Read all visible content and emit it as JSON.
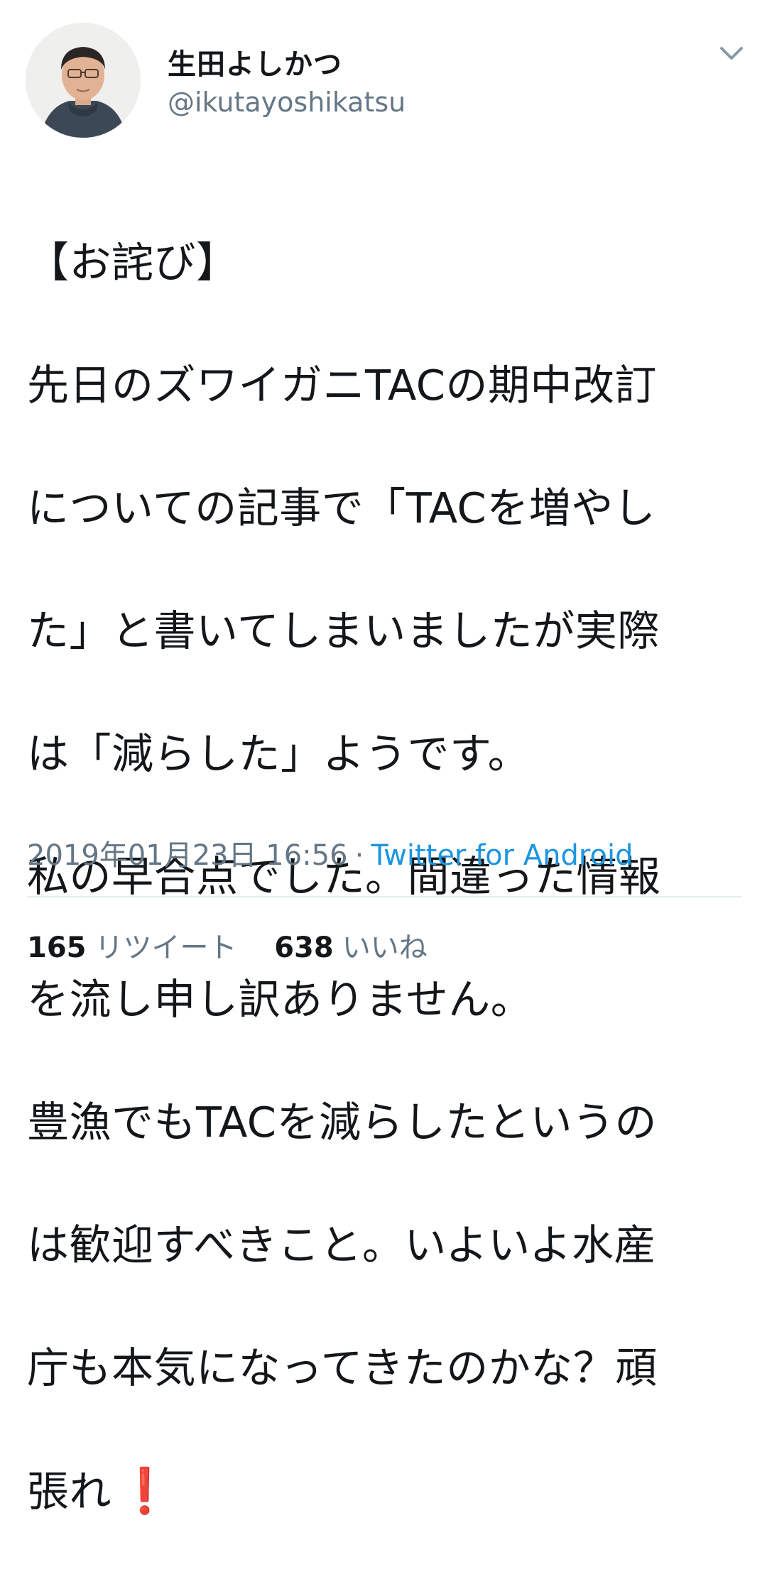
{
  "user": {
    "display_name": "生田よしかつ",
    "handle": "@ikutayoshikatsu"
  },
  "tweet": {
    "lines": [
      "【お詫び】",
      "先日のズワイガニTACの期中改訂",
      "についての記事で「TACを増やし",
      "た」と書いてしまいましたが実際",
      "は「減らした」ようです。",
      "私の早合点でした。間違った情報",
      "を流し申し訳ありません。",
      "豊漁でもTACを減らしたというの",
      "は歓迎すべきこと。いよいよ水産",
      "庁も本気になってきたのかな？頑",
      "張れ"
    ],
    "emoji": "❗"
  },
  "meta": {
    "timestamp": "2019年01月23日 16:56",
    "separator": "·",
    "source": "Twitter for Android"
  },
  "stats": {
    "retweets_count": "165",
    "retweets_label": "リツイート",
    "likes_count": "638",
    "likes_label": "いいね"
  },
  "icons": {
    "menu": "chevron-down-icon",
    "emoji": "red-exclamation-emoji"
  },
  "colors": {
    "text": "#14171a",
    "secondary": "#657786",
    "link": "#1b95e0",
    "divider": "#e6ecf0",
    "emoji": "#e0242a"
  }
}
